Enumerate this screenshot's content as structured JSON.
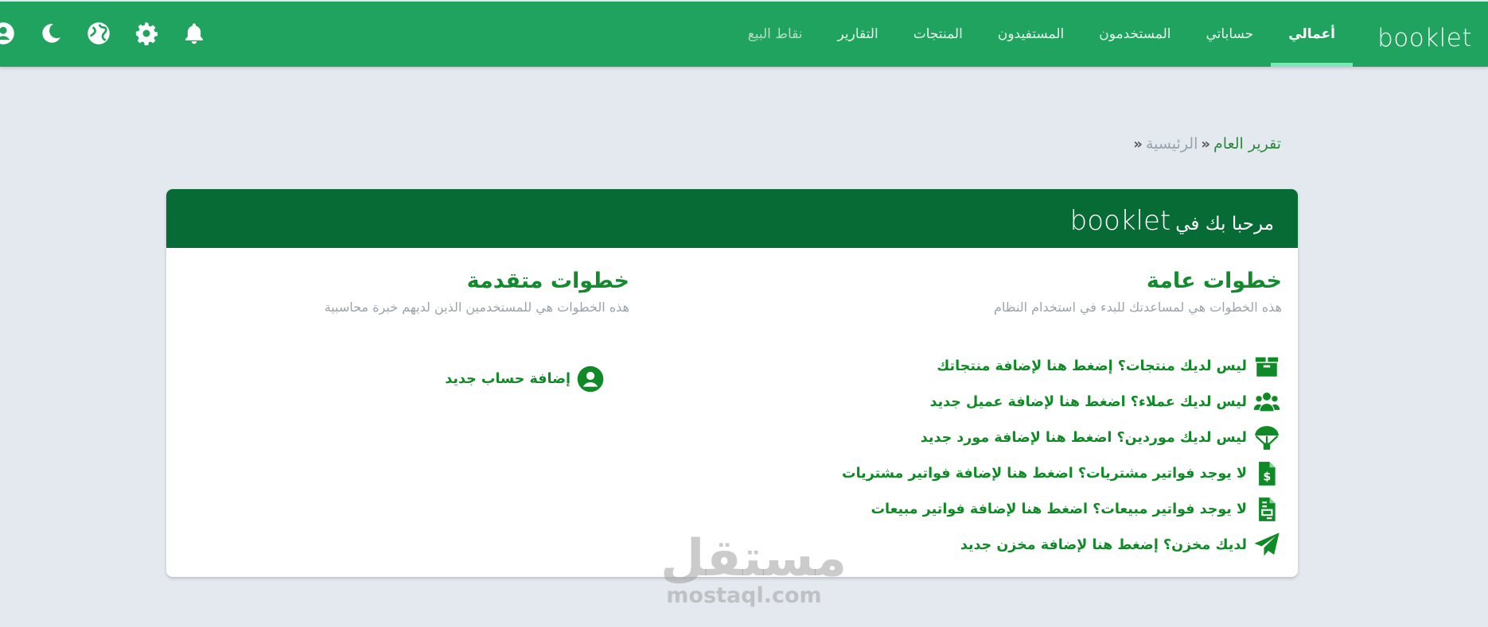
{
  "app": {
    "brand": "booklet",
    "nav": [
      {
        "label": "أعمالي",
        "active": true
      },
      {
        "label": "حساباتي"
      },
      {
        "label": "المستخدمون"
      },
      {
        "label": "المستفيدون"
      },
      {
        "label": "المنتجات"
      },
      {
        "label": "التقارير"
      },
      {
        "label": "نقاط البيع"
      }
    ],
    "tools": [
      "bell-icon",
      "gear-icon",
      "globe-icon",
      "moon-icon",
      "user-icon"
    ]
  },
  "breadcrumb": {
    "home": "الرئيسية",
    "current": "تقرير العام"
  },
  "card": {
    "welcome": "مرحبا بك في",
    "brand": "booklet",
    "general": {
      "title": "خطوات عامة",
      "subtitle": "هذه الخطوات هي لمساعدتك للبدء في استخدام النظام",
      "steps": [
        {
          "label": "ليس لديك منتجات؟ إضغط هنا لإضافة منتجاتك",
          "icon": "box-icon"
        },
        {
          "label": "ليس لديك عملاء؟ اضغط هنا لإضافة عميل جديد",
          "icon": "users-icon"
        },
        {
          "label": "ليس لديك موردين؟ اضغط هنا لإضافة مورد جديد",
          "icon": "parachute-icon"
        },
        {
          "label": "لا يوجد فواتير مشتريات؟ اضغط هنا لإضافة فواتير مشتريات",
          "icon": "invoice-dollar-icon"
        },
        {
          "label": "لا يوجد فواتير مبيعات؟ اضغط هنا لإضافة فواتير مبيعات",
          "icon": "invoice-icon"
        },
        {
          "label": "لديك مخزن؟ إضغط هنا لإضافة مخزن جديد",
          "icon": "paper-plane-icon"
        }
      ]
    },
    "advanced": {
      "title": "خطوات متقدمة",
      "subtitle": "هذه الخطوات هي للمستخدمين الذين لديهم خبرة محاسبية",
      "steps": [
        {
          "label": "إضافة حساب جديد",
          "icon": "user-circle-icon"
        }
      ]
    }
  },
  "watermark": {
    "arabic": "مستقل",
    "latin": "mostaql.com"
  }
}
